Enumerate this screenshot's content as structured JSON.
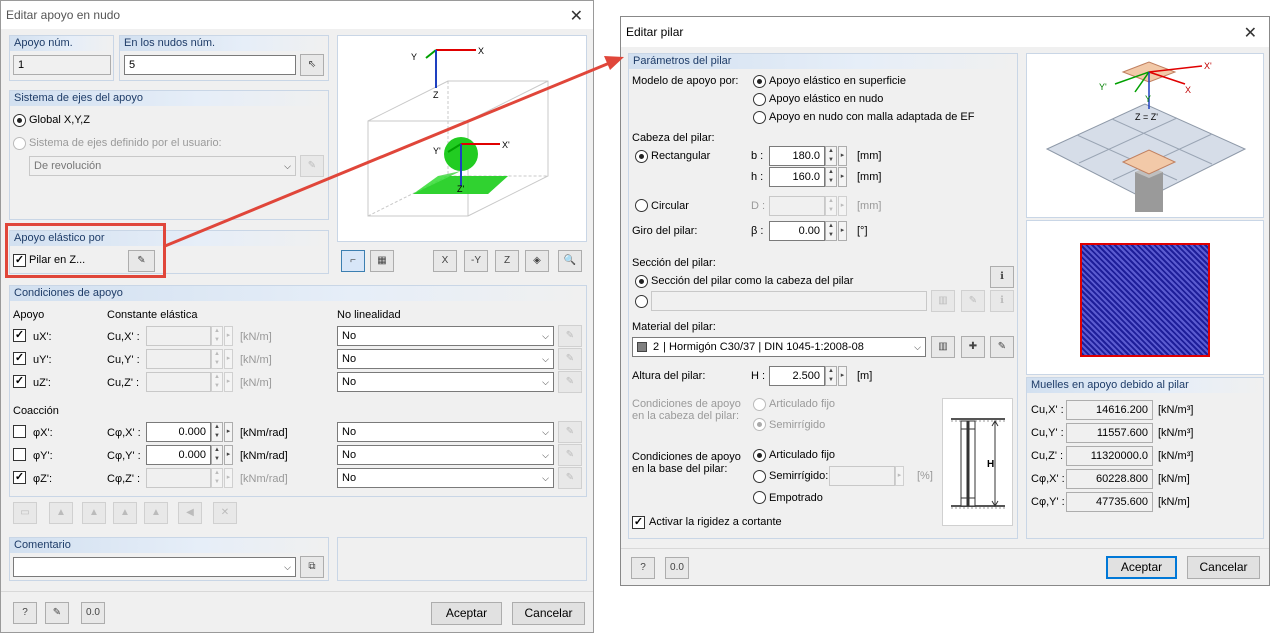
{
  "left": {
    "title": "Editar apoyo en nudo",
    "support_no": {
      "label": "Apoyo núm.",
      "value": "1"
    },
    "nodes": {
      "label": "En los nudos núm.",
      "value": "5"
    },
    "axes": {
      "header": "Sistema de ejes del apoyo",
      "global": "Global X,Y,Z",
      "user": "Sistema de ejes definido por el usuario:",
      "user_value": "De revolución"
    },
    "view_labels": {
      "y": "Y",
      "x": "X",
      "z": "Z",
      "y2": "Y'",
      "x2": "X'",
      "z2": "Z'"
    },
    "elastic": {
      "header": "Apoyo elástico por",
      "column": "Pilar en Z..."
    },
    "conditions": {
      "header": "Condiciones de apoyo",
      "col_support": "Apoyo",
      "col_const": "Constante elástica",
      "col_nonlin": "No linealidad",
      "rows": [
        {
          "name": "uX':",
          "sym": "Cu,X' :",
          "value": "",
          "unit": "[kN/m]",
          "nl": "No"
        },
        {
          "name": "uY':",
          "sym": "Cu,Y' :",
          "value": "",
          "unit": "[kN/m]",
          "nl": "No"
        },
        {
          "name": "uZ':",
          "sym": "Cu,Z' :",
          "value": "",
          "unit": "[kN/m]",
          "nl": "No"
        }
      ],
      "restraint": "Coacción",
      "rows2": [
        {
          "name": "φX':",
          "sym": "Cφ,X' :",
          "value": "0.000",
          "unit": "[kNm/rad]",
          "nl": "No"
        },
        {
          "name": "φY':",
          "sym": "Cφ,Y' :",
          "value": "0.000",
          "unit": "[kNm/rad]",
          "nl": "No"
        },
        {
          "name": "φZ':",
          "sym": "Cφ,Z' :",
          "value": "",
          "unit": "[kNm/rad]",
          "nl": "No"
        }
      ]
    },
    "comment": {
      "header": "Comentario",
      "value": ""
    },
    "ok": "Aceptar",
    "cancel": "Cancelar"
  },
  "right": {
    "title": "Editar pilar",
    "params_header": "Parámetros del pilar",
    "model": {
      "label": "Modelo de apoyo por:",
      "opt1": "Apoyo elástico en superficie",
      "opt2": "Apoyo elástico en nudo",
      "opt3": "Apoyo en nudo con malla adaptada de EF"
    },
    "head": {
      "label": "Cabeza del pilar:",
      "rect": "Rectangular",
      "circ": "Circular",
      "b_sym": "b :",
      "b_val": "180.0",
      "h_sym": "h :",
      "h_val": "160.0",
      "d_sym": "D :",
      "d_val": "",
      "unit": "[mm]"
    },
    "rot": {
      "label": "Giro del pilar:",
      "sym": "β :",
      "value": "0.00",
      "unit": "[°]"
    },
    "section": {
      "label": "Sección del pilar:",
      "opt1": "Sección del pilar como la cabeza del pilar",
      "opt2": ""
    },
    "material": {
      "label": "Material del pilar:",
      "num": "2",
      "value": "Hormigón C30/37 | DIN 1045-1:2008-08"
    },
    "height": {
      "label": "Altura del pilar:",
      "sym": "H :",
      "value": "2.500",
      "unit": "[m]"
    },
    "headcond": {
      "label1": "Condiciones de apoyo",
      "label2": "en la cabeza del pilar:",
      "opt1": "Articulado fijo",
      "opt2": "Semirrígido"
    },
    "basecond": {
      "label1": "Condiciones de apoyo",
      "label2": "en la base del pilar:",
      "opt1": "Articulado fijo",
      "opt2": "Semirrígido:",
      "opt3": "Empotrado",
      "unit": "[%]"
    },
    "shear": "Activar la rigidez a cortante",
    "springs": {
      "header": "Muelles en apoyo debido al pilar",
      "rows": [
        {
          "sym": "Cu,X' :",
          "value": "14616.200",
          "unit": "[kN/m³]"
        },
        {
          "sym": "Cu,Y' :",
          "value": "11557.600",
          "unit": "[kN/m³]"
        },
        {
          "sym": "Cu,Z' :",
          "value": "11320000.0",
          "unit": "[kN/m³]"
        },
        {
          "sym": "Cφ,X' :",
          "value": "60228.800",
          "unit": "[kN/m]"
        },
        {
          "sym": "Cφ,Y' :",
          "value": "47735.600",
          "unit": "[kN/m]"
        }
      ]
    },
    "img_labels": {
      "x2": "X'",
      "x": "X",
      "y2": "Y'",
      "y": "Y",
      "z": "Z = Z'",
      "h": "H"
    },
    "ok": "Aceptar",
    "cancel": "Cancelar"
  },
  "colors": {
    "accent": "#0078d7",
    "highlight": "#e0463a",
    "section_fill": "#1e1e9a",
    "section_border": "#e00000"
  },
  "icons": [
    "close-icon",
    "pick-icon",
    "edit-icon",
    "help-icon",
    "info-icon",
    "library-icon",
    "new-material-icon",
    "units-icon"
  ]
}
